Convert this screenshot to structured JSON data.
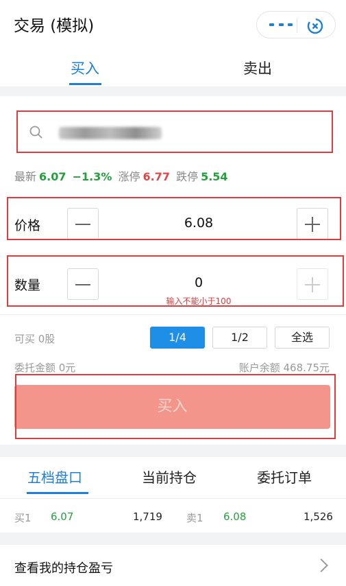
{
  "header": {
    "title": "交易 (模拟)",
    "more_icon": "more-dots-icon",
    "close_icon": "mini-program-close-icon"
  },
  "tabs": [
    {
      "label": "买入",
      "active": true
    },
    {
      "label": "卖出",
      "active": false
    }
  ],
  "search": {
    "icon": "search-icon",
    "value_obscured": true
  },
  "quote": {
    "latest_label": "最新",
    "latest_price": "6.07",
    "change": "−1.3%",
    "limit_up_label": "涨停",
    "limit_up": "6.77",
    "limit_down_label": "跌停",
    "limit_down": "5.54"
  },
  "price": {
    "label": "价格",
    "value": "6.08"
  },
  "quantity": {
    "label": "数量",
    "value": "0",
    "error": "输入不能小于100"
  },
  "available": {
    "text": "可买 0股"
  },
  "ratios": [
    {
      "label": "1/4",
      "active": true
    },
    {
      "label": "1/2",
      "active": false
    },
    {
      "label": "全选",
      "active": false
    }
  ],
  "entrust": {
    "text": "委托金额 0元"
  },
  "balance": {
    "text": "账户余额 468.75元"
  },
  "buy_button": {
    "label": "买入"
  },
  "bottom_tabs": [
    {
      "label": "五档盘口",
      "active": true
    },
    {
      "label": "当前持仓",
      "active": false
    },
    {
      "label": "委托订单",
      "active": false
    }
  ],
  "order_book": {
    "bid_label": "买1",
    "bid_price": "6.07",
    "bid_volume": "1,719",
    "ask_label": "卖1",
    "ask_price": "6.08",
    "ask_volume": "1,526"
  },
  "footer": {
    "link_text": "查看我的持仓盈亏"
  },
  "colors": {
    "accent": "#1e7fd6",
    "up": "#e04848",
    "down": "#22a13a",
    "buy_button": "#f3958a",
    "highlight_box": "#e23b3b"
  }
}
